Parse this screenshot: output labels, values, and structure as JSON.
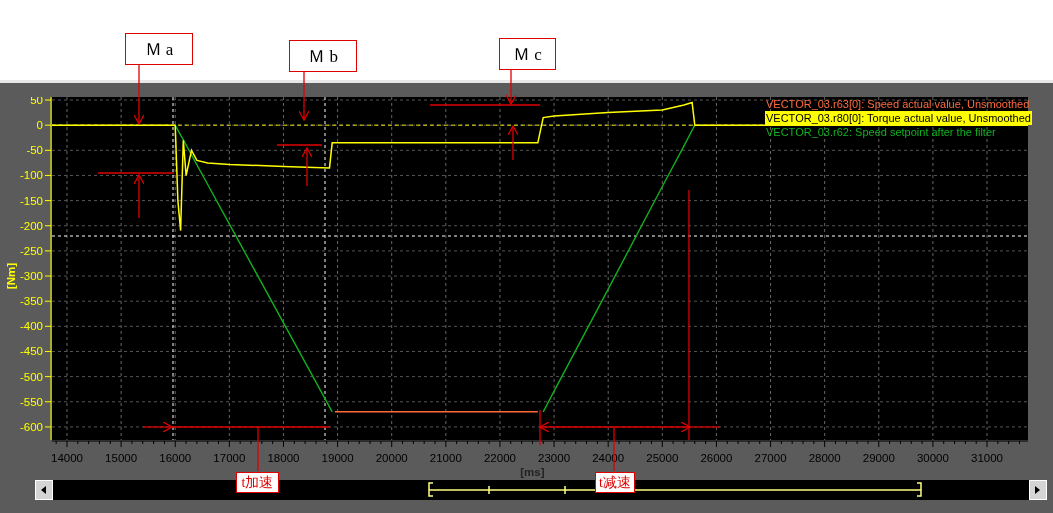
{
  "trace": {
    "chart_data": {
      "type": "line",
      "xlabel": "[ms]",
      "ylabel": "[Nm]",
      "x": [
        13723,
        15900,
        16000,
        16050,
        16100,
        16150,
        16200,
        16300,
        16400,
        16600,
        17000,
        18000,
        18850,
        18900,
        18950,
        19500,
        22000,
        22700,
        22800,
        23000,
        24000,
        25000,
        25400,
        25550,
        25600,
        25700,
        31757
      ],
      "series": [
        {
          "name": "VECTOR_03.r63[0]: Speed actual value, Unsmoothed",
          "color": "#ff6a3c",
          "values": [
            null,
            null,
            null,
            null,
            null,
            null,
            null,
            null,
            null,
            null,
            null,
            null,
            null,
            null,
            -570,
            -570,
            -570,
            -570,
            null,
            null,
            null,
            null,
            null,
            null,
            null,
            null,
            null
          ]
        },
        {
          "name": "VECTOR_03.r80[0]: Torque actual value, Unsmoothed",
          "color": "#ffff00",
          "values": [
            0,
            0,
            0,
            -150,
            -210,
            -30,
            -100,
            -50,
            -70,
            -75,
            -78,
            -82,
            -85,
            -35,
            -35,
            -35,
            -35,
            -35,
            15,
            18,
            25,
            30,
            40,
            45,
            0,
            0,
            0
          ]
        },
        {
          "name": "VECTOR_03.r62: Speed setpoint after the filter",
          "color": "#10b020",
          "values": [
            null,
            null,
            0,
            -10,
            -20,
            -29,
            -39,
            -59,
            -79,
            -118,
            -197,
            -393,
            -560,
            -570,
            null,
            null,
            null,
            null,
            -570,
            -529,
            -326,
            -122,
            -41,
            -10,
            0,
            null,
            null
          ]
        }
      ],
      "ref_lines": [
        {
          "axis": "y",
          "value": 0
        }
      ],
      "xlim": [
        13723,
        31757
      ],
      "ylim": [
        -626,
        56
      ],
      "grid": true,
      "xticks": [
        14000,
        15000,
        16000,
        17000,
        18000,
        19000,
        20000,
        21000,
        22000,
        23000,
        24000,
        25000,
        26000,
        27000,
        28000,
        29000,
        30000,
        31000
      ],
      "yticks": [
        50,
        0,
        -50,
        -100,
        -150,
        -200,
        -250,
        -300,
        -350,
        -400,
        -450,
        -500,
        -550,
        -600
      ]
    },
    "legend": [
      {
        "selected": false
      },
      {
        "selected": true
      },
      {
        "selected": false
      }
    ]
  },
  "callouts": [
    {
      "label": "Ｍ a"
    },
    {
      "label": "Ｍ b"
    },
    {
      "label": "Ｍ c"
    },
    {
      "label": "t加速"
    },
    {
      "label": "t减速"
    }
  ]
}
